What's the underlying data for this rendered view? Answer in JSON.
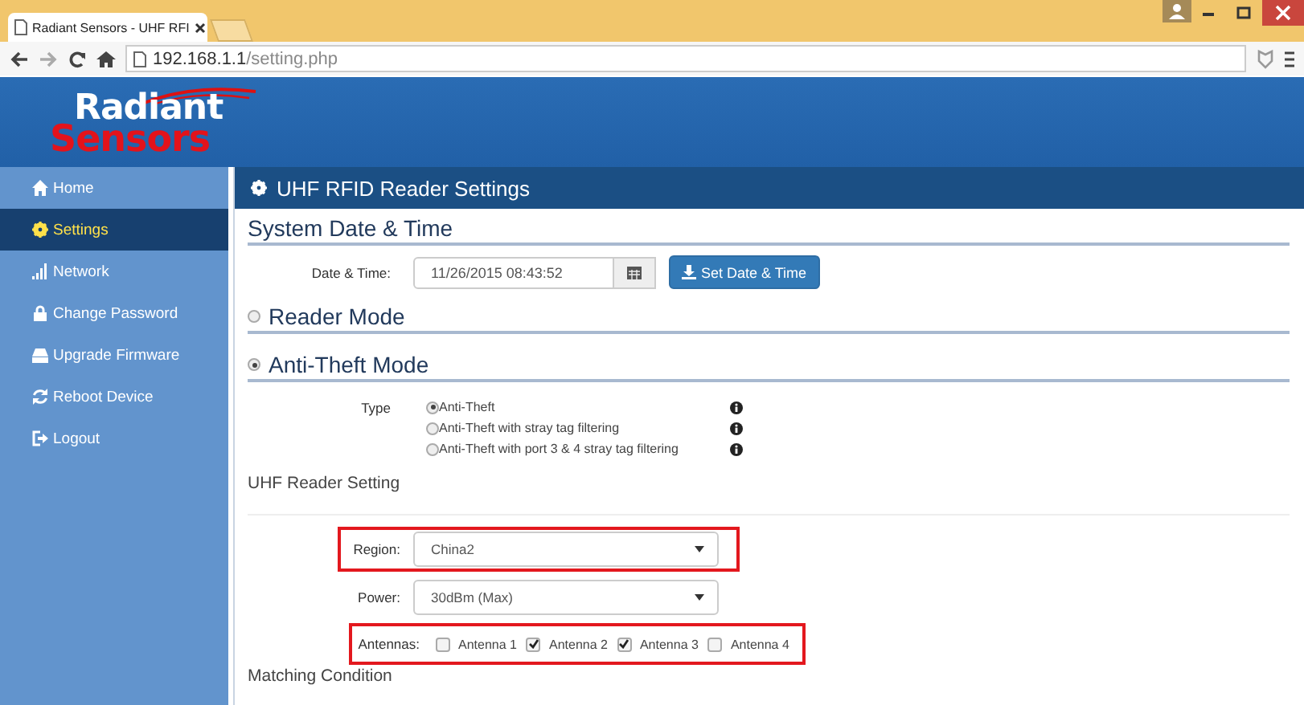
{
  "browser": {
    "tab_title": "Radiant Sensors - UHF RFI",
    "url_host": "192.168.1.1",
    "url_path": "/setting.php"
  },
  "header": {
    "logo_top": "Radiant",
    "logo_bottom": "Sensors"
  },
  "sidebar": {
    "items": [
      {
        "label": "Home",
        "selected": false
      },
      {
        "label": "Settings",
        "selected": true
      },
      {
        "label": "Network",
        "selected": false
      },
      {
        "label": "Change Password",
        "selected": false
      },
      {
        "label": "Upgrade Firmware",
        "selected": false
      },
      {
        "label": "Reboot Device",
        "selected": false
      },
      {
        "label": "Logout",
        "selected": false
      }
    ]
  },
  "panel": {
    "title": "UHF RFID Reader Settings",
    "date_section": {
      "heading": "System Date & Time",
      "label": "Date & Time:",
      "value": "11/26/2015 08:43:52",
      "button": "Set Date & Time"
    },
    "modes": [
      {
        "label": "Reader Mode",
        "selected": false
      },
      {
        "label": "Anti-Theft Mode",
        "selected": true
      }
    ],
    "type": {
      "label": "Type",
      "options": [
        {
          "label": "Anti-Theft",
          "selected": true
        },
        {
          "label": "Anti-Theft with stray tag filtering",
          "selected": false
        },
        {
          "label": "Anti-Theft with port 3 & 4 stray tag filtering",
          "selected": false
        }
      ]
    },
    "uhf_heading": "UHF Reader Setting",
    "region": {
      "label": "Region:",
      "value": "China2",
      "highlighted": true
    },
    "power": {
      "label": "Power:",
      "value": "30dBm (Max)",
      "highlighted": false
    },
    "antennas": {
      "label": "Antennas:",
      "highlighted": true,
      "items": [
        {
          "label": "Antenna 1",
          "checked": false
        },
        {
          "label": "Antenna 2",
          "checked": true
        },
        {
          "label": "Antenna 3",
          "checked": true
        },
        {
          "label": "Antenna 4",
          "checked": false
        }
      ]
    },
    "matching_heading": "Matching Condition"
  }
}
